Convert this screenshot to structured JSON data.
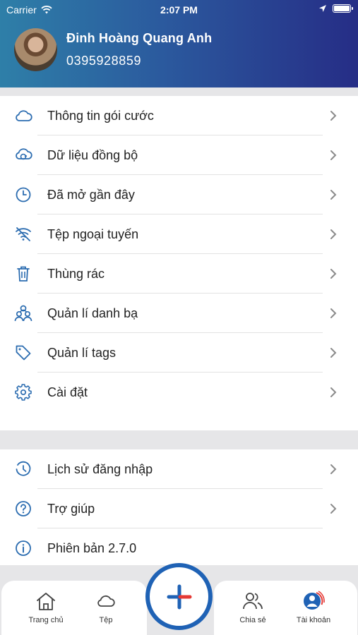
{
  "status_bar": {
    "carrier": "Carrier",
    "time": "2:07 PM"
  },
  "profile": {
    "name": "Đinh Hoàng Quang Anh",
    "phone": "0395928859"
  },
  "menu_main": [
    {
      "label": "Thông tin gói cước",
      "icon": "cloud-icon"
    },
    {
      "label": "Dữ liệu đồng bộ",
      "icon": "cloud-sync-icon"
    },
    {
      "label": "Đã mở gần đây",
      "icon": "clock-icon"
    },
    {
      "label": "Tệp ngoại tuyến",
      "icon": "wifi-off-icon"
    },
    {
      "label": "Thùng rác",
      "icon": "trash-icon"
    },
    {
      "label": "Quản lí danh bạ",
      "icon": "contacts-icon"
    },
    {
      "label": "Quản lí tags",
      "icon": "tag-icon"
    },
    {
      "label": "Cài đặt",
      "icon": "gear-icon"
    }
  ],
  "menu_secondary": [
    {
      "label": "Lịch sử đăng nhập",
      "icon": "history-icon"
    },
    {
      "label": "Trợ giúp",
      "icon": "help-icon"
    },
    {
      "label": "Phiên bản 2.7.0",
      "icon": "info-icon"
    }
  ],
  "tabs": {
    "home": "Trang chủ",
    "files": "Tệp",
    "share": "Chia sẻ",
    "account": "Tài khoản"
  },
  "colors": {
    "accent": "#2b6cb0",
    "fab_border": "#1f62b5",
    "fab_red": "#e53935",
    "header_start": "#2e7fa8",
    "header_end": "#262d86"
  }
}
